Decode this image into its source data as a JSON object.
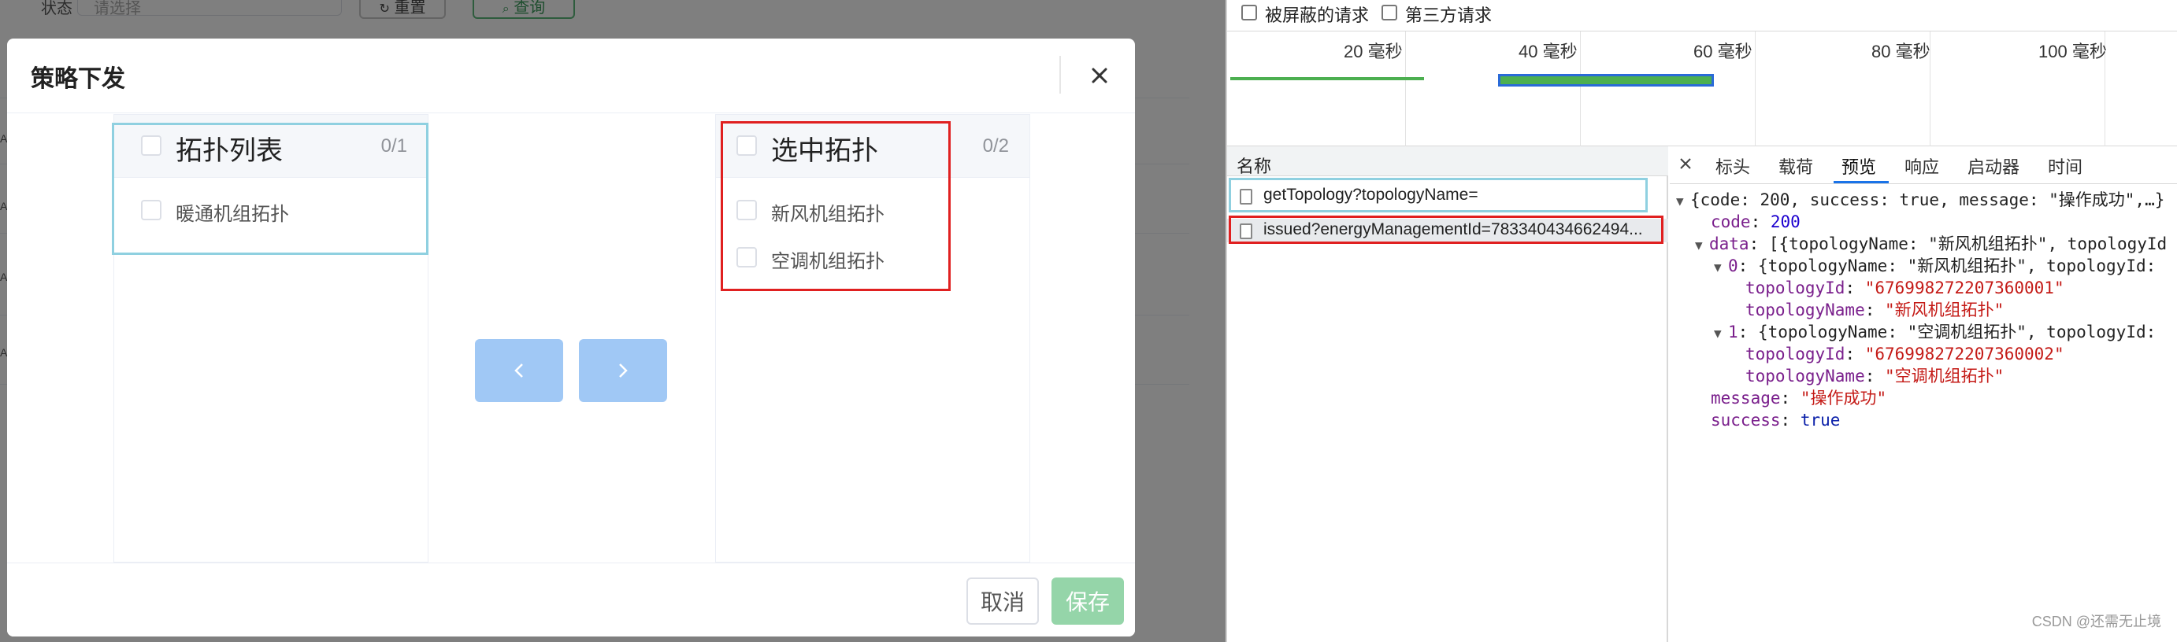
{
  "background": {
    "field_label": "状态",
    "field_placeholder": "请选择",
    "reset_label": "重置",
    "query_label": "查询",
    "row_labels": [
      "Ad",
      "Ad",
      "Ad",
      "Ad"
    ]
  },
  "modal": {
    "title": "策略下发",
    "source": {
      "title": "拓扑列表",
      "count": "0/1",
      "items": [
        "暖通机组拓扑"
      ]
    },
    "target": {
      "title": "选中拓扑",
      "count": "0/2",
      "items": [
        "新风机组拓扑",
        "空调机组拓扑"
      ]
    },
    "cancel_label": "取消",
    "save_label": "保存"
  },
  "devtools": {
    "filters": [
      "被屏蔽的请求",
      "第三方请求"
    ],
    "timeline_ticks": [
      "20 毫秒",
      "40 毫秒",
      "60 毫秒",
      "80 毫秒",
      "100 毫秒"
    ],
    "name_header": "名称",
    "requests": [
      "getTopology?topologyName=",
      "issued?energyManagementId=783340434662494..."
    ],
    "tabs": [
      "标头",
      "载荷",
      "预览",
      "响应",
      "启动器",
      "时间"
    ],
    "active_tab": "预览",
    "preview": {
      "summary": "{code: 200, success: true, message: \"操作成功\",…}",
      "code_key": "code",
      "code_value": "200",
      "data_key": "data",
      "data_summary": "[{topologyName: \"新风机组拓扑\", topologyId",
      "items": [
        {
          "index": "0",
          "summary": "{topologyName: \"新风机组拓扑\", topologyId:",
          "topologyId": "\"676998272207360001\"",
          "topologyName": "\"新风机组拓扑\""
        },
        {
          "index": "1",
          "summary": "{topologyName: \"空调机组拓扑\", topologyId:",
          "topologyId": "\"676998272207360002\"",
          "topologyName": "\"空调机组拓扑\""
        }
      ],
      "message_key": "message",
      "message_value": "\"操作成功\"",
      "success_key": "success",
      "success_value": "true"
    },
    "watermark": "CSDN @还需无止境"
  }
}
